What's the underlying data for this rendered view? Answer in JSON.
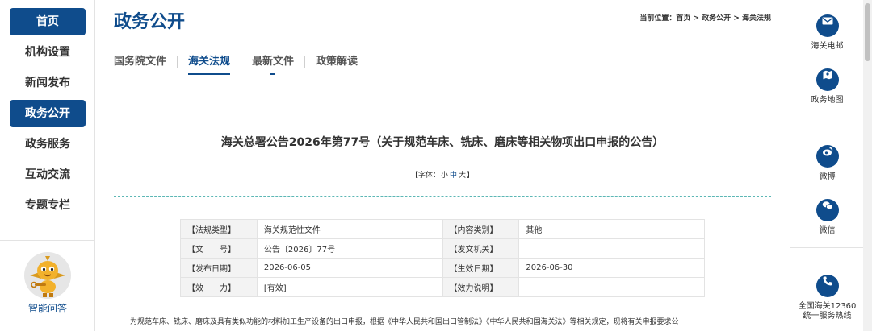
{
  "nav": {
    "items": [
      {
        "label": "首页",
        "active": true
      },
      {
        "label": "机构设置",
        "active": false
      },
      {
        "label": "新闻发布",
        "active": false
      },
      {
        "label": "政务公开",
        "active": true
      },
      {
        "label": "政务服务",
        "active": false
      },
      {
        "label": "互动交流",
        "active": false
      },
      {
        "label": "专题专栏",
        "active": false
      }
    ],
    "assistant_label": "智能问答"
  },
  "main": {
    "title": "政务公开",
    "breadcrumb": {
      "prefix": "当前位置：",
      "home": "首页",
      "sep": " > ",
      "section": "政务公开",
      "current": "海关法规"
    },
    "tabs": [
      {
        "label": "国务院文件",
        "state": "normal"
      },
      {
        "label": "海关法规",
        "state": "active"
      },
      {
        "label": "最新文件",
        "state": "dash"
      },
      {
        "label": "政策解读",
        "state": "normal"
      }
    ]
  },
  "article": {
    "title": "海关总署公告2026年第77号（关于规范车床、铣床、磨床等相关物项出口申报的公告）",
    "font_size": {
      "prefix": "【字体：",
      "small": "小",
      "medium": "中",
      "large": "大",
      "suffix": "】"
    },
    "meta": [
      [
        {
          "label": "【法规类型】",
          "value": "海关规范性文件"
        },
        {
          "label": "【内容类别】",
          "value": "其他"
        }
      ],
      [
        {
          "label": "【文　　号】",
          "value": "公告〔2026〕77号"
        },
        {
          "label": "【发文机关】",
          "value": ""
        }
      ],
      [
        {
          "label": "【发布日期】",
          "value": "2026-06-05"
        },
        {
          "label": "【生效日期】",
          "value": "2026-06-30"
        }
      ],
      [
        {
          "label": "【效　　力】",
          "value": "[有效]"
        },
        {
          "label": "【效力说明】",
          "value": ""
        }
      ]
    ],
    "body_first_line": "为规范车床、铣床、磨床及具有类似功能的材料加工生产设备的出口申报，根据《中华人民共和国出口管制法》《中华人民共和国海关法》等相关规定，现将有关申报要求公"
  },
  "right_rail": {
    "items": [
      {
        "label": "海关电邮",
        "icon": "mail-icon"
      },
      {
        "label": "政务地图",
        "icon": "map-icon"
      },
      {
        "label": "微博",
        "icon": "weibo-icon"
      },
      {
        "label": "微信",
        "icon": "wechat-icon"
      },
      {
        "label": "全国海关12360统一服务热线",
        "icon": "phone-icon"
      }
    ]
  },
  "colors": {
    "brand": "#0f4c8c",
    "rule_teal": "#5cb7b5"
  }
}
